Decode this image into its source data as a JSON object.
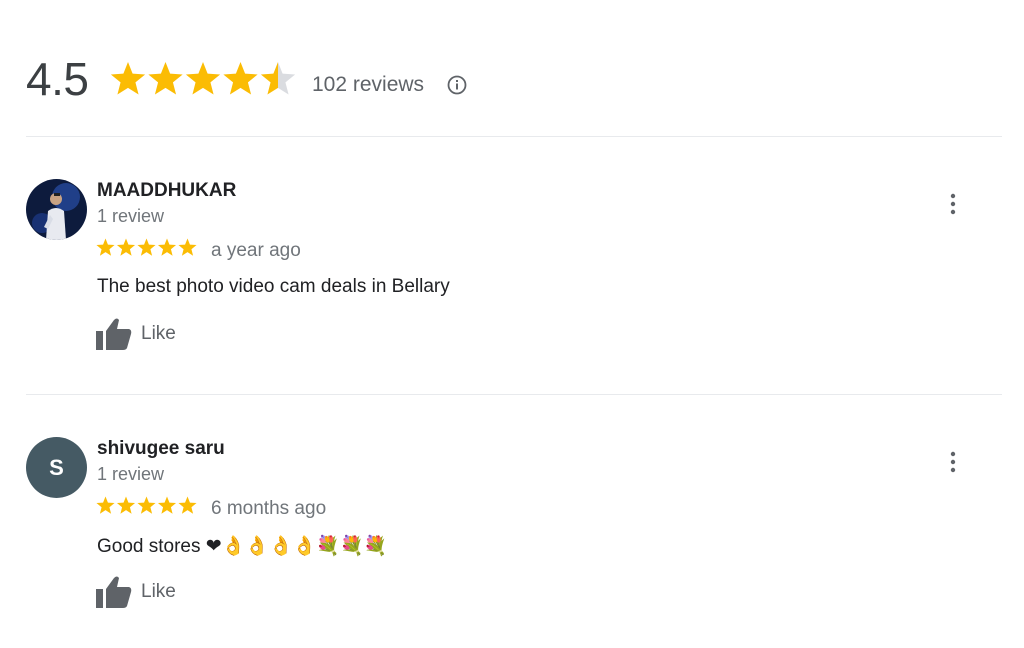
{
  "summary": {
    "rating": "4.5",
    "stars": 4.5,
    "review_count": "102 reviews",
    "info_icon": "info-icon"
  },
  "colors": {
    "star": "#fbbc04",
    "star_empty": "#dadce0",
    "avatar_bg": "#455a64",
    "muted_text": "#70757a"
  },
  "reviews": [
    {
      "name": "MAADDHUKAR",
      "meta": "1 review",
      "stars": 5,
      "date": "a year ago",
      "text": "The best photo video cam deals in Bellary",
      "like_label": "Like",
      "avatar": "photo"
    },
    {
      "name": "shivugee saru",
      "meta": "1 review",
      "stars": 5,
      "date": "6 months ago",
      "text": "Good stores ❤👌👌👌👌💐💐💐",
      "like_label": "Like",
      "avatar_letter": "S"
    }
  ]
}
